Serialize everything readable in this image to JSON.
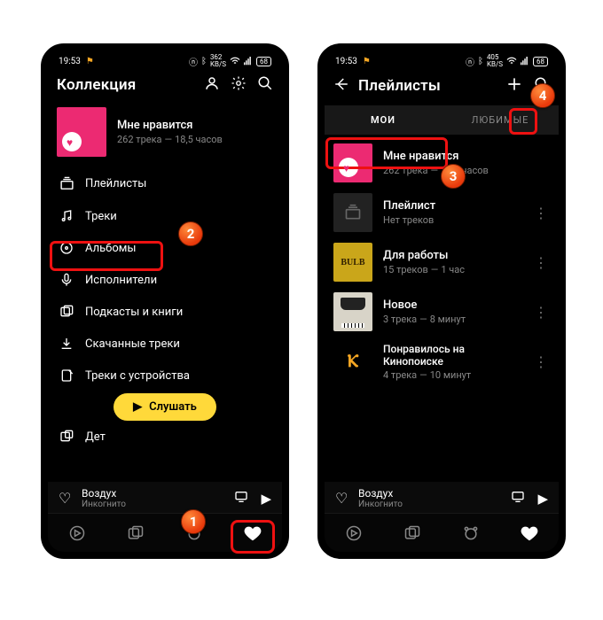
{
  "left": {
    "status": {
      "time": "19:53",
      "net": "362",
      "batt": "68"
    },
    "title": "Коллекция",
    "liked": {
      "title": "Мне нравится",
      "tracks": "262 трека",
      "duration": "18,5 часов"
    },
    "menu": [
      {
        "label": "Плейлисты"
      },
      {
        "label": "Треки"
      },
      {
        "label": "Альбомы"
      },
      {
        "label": "Исполнители"
      },
      {
        "label": "Подкасты и книги"
      },
      {
        "label": "Скачанные треки"
      },
      {
        "label": "Треки с устройства"
      },
      {
        "label": "Дет"
      }
    ],
    "listen": "Слушать",
    "np": {
      "title": "Воздух",
      "sub": "Инкогнито"
    }
  },
  "right": {
    "status": {
      "time": "19:53",
      "net": "405",
      "batt": "68"
    },
    "title": "Плейлисты",
    "seg": {
      "my": "МОИ",
      "fav": "ЛЮБИМЫЕ"
    },
    "rows": [
      {
        "title": "Мне нравится",
        "sub1": "262 трека",
        "sub2": "18,5 часов"
      },
      {
        "title": "Плейлист",
        "sub1": "Нет треков",
        "sub2": ""
      },
      {
        "title": "Для работы",
        "sub1": "15 треков",
        "sub2": "1 час"
      },
      {
        "title": "Новое",
        "sub1": "3 трека",
        "sub2": "8 минут"
      },
      {
        "title": "Понравилось на Кинопоиске",
        "sub1": "4 трека",
        "sub2": "10 минут"
      }
    ],
    "np": {
      "title": "Воздух",
      "sub": "Инкогнито"
    }
  },
  "bubbles": {
    "b1": "1",
    "b2": "2",
    "b3": "3",
    "b4": "4"
  }
}
